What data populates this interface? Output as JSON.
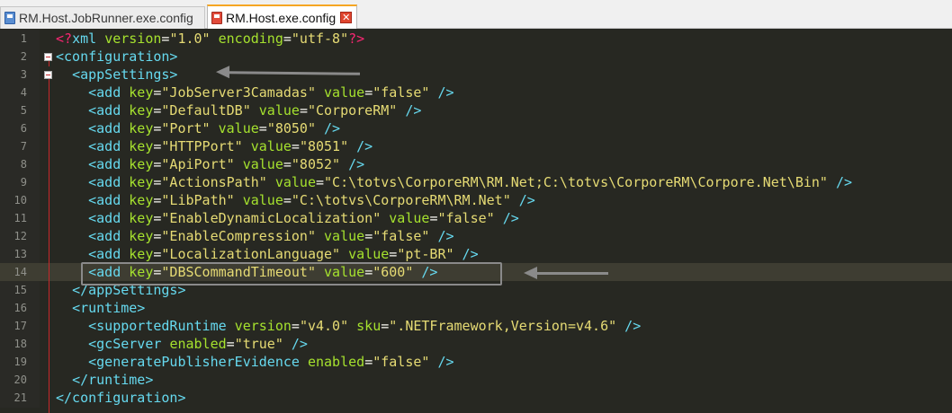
{
  "tabs": [
    {
      "label": "RM.Host.JobRunner.exe.config",
      "icon": "file-icon",
      "active": false
    },
    {
      "label": "RM.Host.exe.config",
      "icon": "file-icon",
      "active": true,
      "close": "✕"
    }
  ],
  "current_line": 14,
  "lines": [
    {
      "number": "1",
      "tokens": [
        [
          "decl",
          "<?"
        ],
        [
          "tag",
          "xml "
        ],
        [
          "attr",
          "version"
        ],
        [
          "eq",
          "="
        ],
        [
          "str",
          "\"1.0\""
        ],
        [
          "eq",
          " "
        ],
        [
          "attr",
          "encoding"
        ],
        [
          "eq",
          "="
        ],
        [
          "str",
          "\"utf-8\""
        ],
        [
          "decl",
          "?>"
        ]
      ]
    },
    {
      "number": "2",
      "tokens": [
        [
          "tag",
          "<configuration>"
        ]
      ]
    },
    {
      "number": "3",
      "tokens": [
        [
          "eq",
          "  "
        ],
        [
          "tag",
          "<appSettings>"
        ]
      ]
    },
    {
      "number": "4",
      "tokens": [
        [
          "eq",
          "    "
        ],
        [
          "tag",
          "<add "
        ],
        [
          "attr",
          "key"
        ],
        [
          "eq",
          "="
        ],
        [
          "str",
          "\"JobServer3Camadas\""
        ],
        [
          "eq",
          " "
        ],
        [
          "attr",
          "value"
        ],
        [
          "eq",
          "="
        ],
        [
          "str",
          "\"false\""
        ],
        [
          "tag",
          " />"
        ]
      ]
    },
    {
      "number": "5",
      "tokens": [
        [
          "eq",
          "    "
        ],
        [
          "tag",
          "<add "
        ],
        [
          "attr",
          "key"
        ],
        [
          "eq",
          "="
        ],
        [
          "str",
          "\"DefaultDB\""
        ],
        [
          "eq",
          " "
        ],
        [
          "attr",
          "value"
        ],
        [
          "eq",
          "="
        ],
        [
          "str",
          "\"CorporeRM\""
        ],
        [
          "tag",
          " />"
        ]
      ]
    },
    {
      "number": "6",
      "tokens": [
        [
          "eq",
          "    "
        ],
        [
          "tag",
          "<add "
        ],
        [
          "attr",
          "key"
        ],
        [
          "eq",
          "="
        ],
        [
          "str",
          "\"Port\""
        ],
        [
          "eq",
          " "
        ],
        [
          "attr",
          "value"
        ],
        [
          "eq",
          "="
        ],
        [
          "str",
          "\"8050\""
        ],
        [
          "tag",
          " />"
        ]
      ]
    },
    {
      "number": "7",
      "tokens": [
        [
          "eq",
          "    "
        ],
        [
          "tag",
          "<add "
        ],
        [
          "attr",
          "key"
        ],
        [
          "eq",
          "="
        ],
        [
          "str",
          "\"HTTPPort\""
        ],
        [
          "eq",
          " "
        ],
        [
          "attr",
          "value"
        ],
        [
          "eq",
          "="
        ],
        [
          "str",
          "\"8051\""
        ],
        [
          "tag",
          " />"
        ]
      ]
    },
    {
      "number": "8",
      "tokens": [
        [
          "eq",
          "    "
        ],
        [
          "tag",
          "<add "
        ],
        [
          "attr",
          "key"
        ],
        [
          "eq",
          "="
        ],
        [
          "str",
          "\"ApiPort\""
        ],
        [
          "eq",
          " "
        ],
        [
          "attr",
          "value"
        ],
        [
          "eq",
          "="
        ],
        [
          "str",
          "\"8052\""
        ],
        [
          "tag",
          " />"
        ]
      ]
    },
    {
      "number": "9",
      "tokens": [
        [
          "eq",
          "    "
        ],
        [
          "tag",
          "<add "
        ],
        [
          "attr",
          "key"
        ],
        [
          "eq",
          "="
        ],
        [
          "str",
          "\"ActionsPath\""
        ],
        [
          "eq",
          " "
        ],
        [
          "attr",
          "value"
        ],
        [
          "eq",
          "="
        ],
        [
          "str",
          "\"C:\\totvs\\CorporeRM\\RM.Net;C:\\totvs\\CorporeRM\\Corpore.Net\\Bin\""
        ],
        [
          "tag",
          " />"
        ]
      ]
    },
    {
      "number": "10",
      "tokens": [
        [
          "eq",
          "    "
        ],
        [
          "tag",
          "<add "
        ],
        [
          "attr",
          "key"
        ],
        [
          "eq",
          "="
        ],
        [
          "str",
          "\"LibPath\""
        ],
        [
          "eq",
          " "
        ],
        [
          "attr",
          "value"
        ],
        [
          "eq",
          "="
        ],
        [
          "str",
          "\"C:\\totvs\\CorporeRM\\RM.Net\""
        ],
        [
          "tag",
          " />"
        ]
      ]
    },
    {
      "number": "11",
      "tokens": [
        [
          "eq",
          "    "
        ],
        [
          "tag",
          "<add "
        ],
        [
          "attr",
          "key"
        ],
        [
          "eq",
          "="
        ],
        [
          "str",
          "\"EnableDynamicLocalization\""
        ],
        [
          "eq",
          " "
        ],
        [
          "attr",
          "value"
        ],
        [
          "eq",
          "="
        ],
        [
          "str",
          "\"false\""
        ],
        [
          "tag",
          " />"
        ]
      ]
    },
    {
      "number": "12",
      "tokens": [
        [
          "eq",
          "    "
        ],
        [
          "tag",
          "<add "
        ],
        [
          "attr",
          "key"
        ],
        [
          "eq",
          "="
        ],
        [
          "str",
          "\"EnableCompression\""
        ],
        [
          "eq",
          " "
        ],
        [
          "attr",
          "value"
        ],
        [
          "eq",
          "="
        ],
        [
          "str",
          "\"false\""
        ],
        [
          "tag",
          " />"
        ]
      ]
    },
    {
      "number": "13",
      "tokens": [
        [
          "eq",
          "    "
        ],
        [
          "tag",
          "<add "
        ],
        [
          "attr",
          "key"
        ],
        [
          "eq",
          "="
        ],
        [
          "str",
          "\"LocalizationLanguage\""
        ],
        [
          "eq",
          " "
        ],
        [
          "attr",
          "value"
        ],
        [
          "eq",
          "="
        ],
        [
          "str",
          "\"pt-BR\""
        ],
        [
          "tag",
          " />"
        ]
      ]
    },
    {
      "number": "14",
      "tokens": [
        [
          "eq",
          "    "
        ],
        [
          "tag",
          "<add "
        ],
        [
          "attr",
          "key"
        ],
        [
          "eq",
          "="
        ],
        [
          "str",
          "\"DBSCommandTimeout\""
        ],
        [
          "eq",
          " "
        ],
        [
          "attr",
          "value"
        ],
        [
          "eq",
          "="
        ],
        [
          "str",
          "\"600\""
        ],
        [
          "tag",
          " />"
        ]
      ]
    },
    {
      "number": "15",
      "tokens": [
        [
          "eq",
          "  "
        ],
        [
          "tag",
          "</appSettings>"
        ]
      ]
    },
    {
      "number": "16",
      "tokens": [
        [
          "eq",
          "  "
        ],
        [
          "tag",
          "<runtime>"
        ]
      ]
    },
    {
      "number": "17",
      "tokens": [
        [
          "eq",
          "    "
        ],
        [
          "tag",
          "<supportedRuntime "
        ],
        [
          "attr",
          "version"
        ],
        [
          "eq",
          "="
        ],
        [
          "str",
          "\"v4.0\""
        ],
        [
          "eq",
          " "
        ],
        [
          "attr",
          "sku"
        ],
        [
          "eq",
          "="
        ],
        [
          "str",
          "\".NETFramework,Version=v4.6\""
        ],
        [
          "tag",
          " />"
        ]
      ]
    },
    {
      "number": "18",
      "tokens": [
        [
          "eq",
          "    "
        ],
        [
          "tag",
          "<gcServer "
        ],
        [
          "attr",
          "enabled"
        ],
        [
          "eq",
          "="
        ],
        [
          "str",
          "\"true\""
        ],
        [
          "tag",
          " />"
        ]
      ]
    },
    {
      "number": "19",
      "tokens": [
        [
          "eq",
          "    "
        ],
        [
          "tag",
          "<generatePublisherEvidence "
        ],
        [
          "attr",
          "enabled"
        ],
        [
          "eq",
          "="
        ],
        [
          "str",
          "\"false\""
        ],
        [
          "tag",
          " />"
        ]
      ]
    },
    {
      "number": "20",
      "tokens": [
        [
          "eq",
          "  "
        ],
        [
          "tag",
          "</runtime>"
        ]
      ]
    },
    {
      "number": "21",
      "tokens": [
        [
          "tag",
          "</configuration>"
        ]
      ]
    }
  ]
}
